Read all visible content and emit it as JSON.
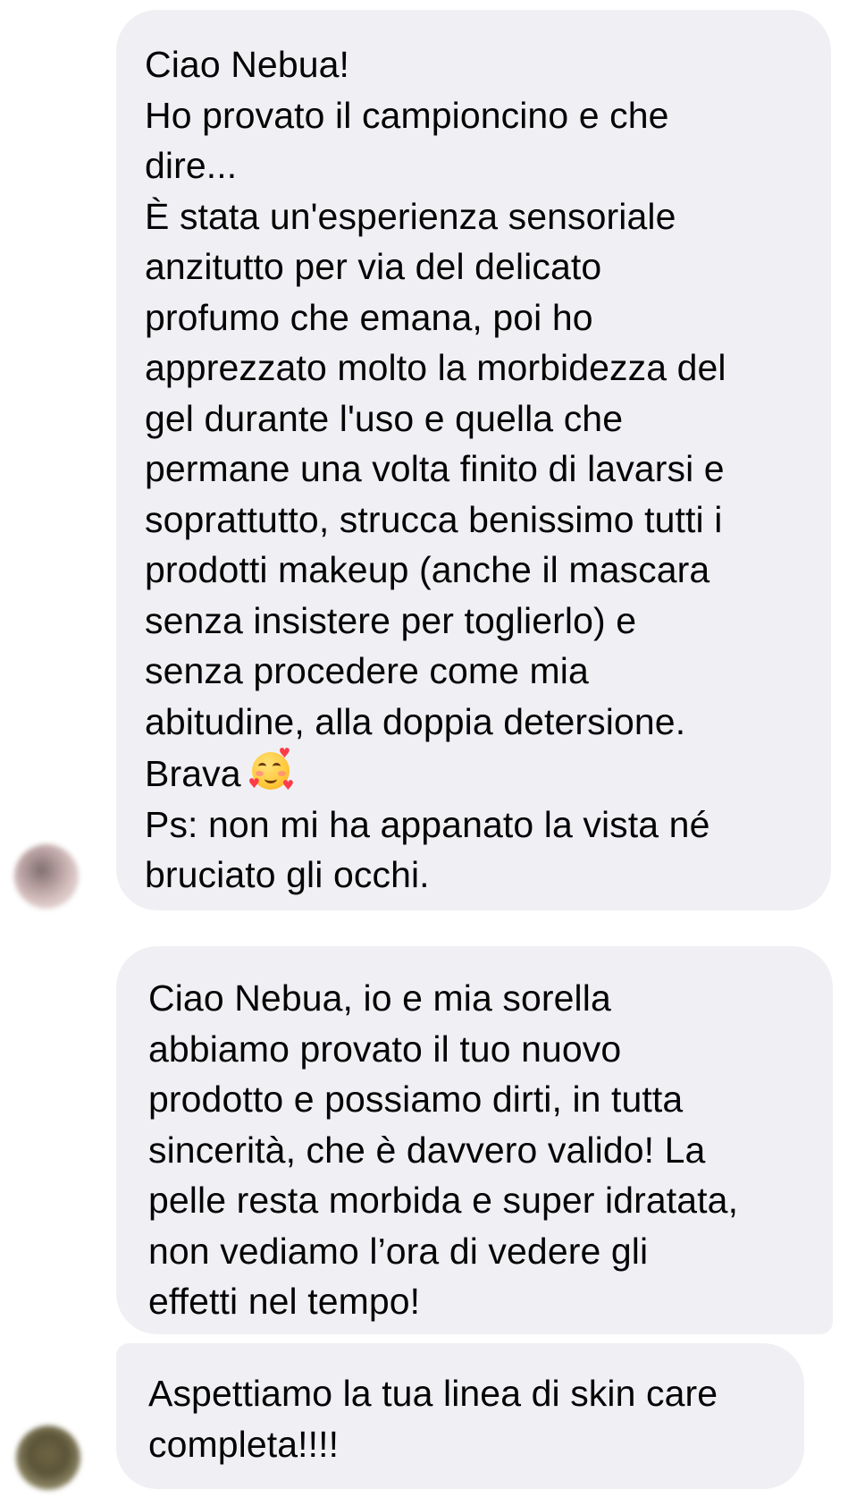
{
  "conversation": {
    "messages": [
      {
        "lines": [
          "Ciao Nebua!",
          "Ho provato il campioncino e che",
          "dire...",
          "È  stata  un'esperienza sensoriale",
          "anzitutto per via del delicato",
          "profumo che emana, poi ho",
          "apprezzato molto la morbidezza del",
          "gel durante l'uso e quella che",
          "permane una volta finito di lavarsi e",
          "soprattutto, strucca benissimo tutti i",
          "prodotti makeup (anche il mascara",
          "senza insistere per toglierlo) e",
          "senza procedere come mia",
          "abitudine, alla doppia detersione.",
          "Brava",
          "Ps: non mi ha appanato la vista né",
          "bruciato gli occhi."
        ],
        "emoji": "smiling-face-with-hearts"
      },
      {
        "lines": [
          "Ciao Nebua, io e mia sorella",
          "abbiamo provato il tuo nuovo",
          "prodotto e possiamo dirti, in tutta",
          "sincerità, che è davvero valido! La",
          "pelle resta morbida e super idratata,",
          "non vediamo l’ora di vedere gli",
          "effetti nel tempo!"
        ]
      },
      {
        "lines": [
          "Aspettiamo la tua linea di skin care",
          "completa!!!!"
        ]
      }
    ]
  },
  "colors": {
    "bubble": "#f0f0f4",
    "text": "#050505",
    "background": "#ffffff"
  }
}
